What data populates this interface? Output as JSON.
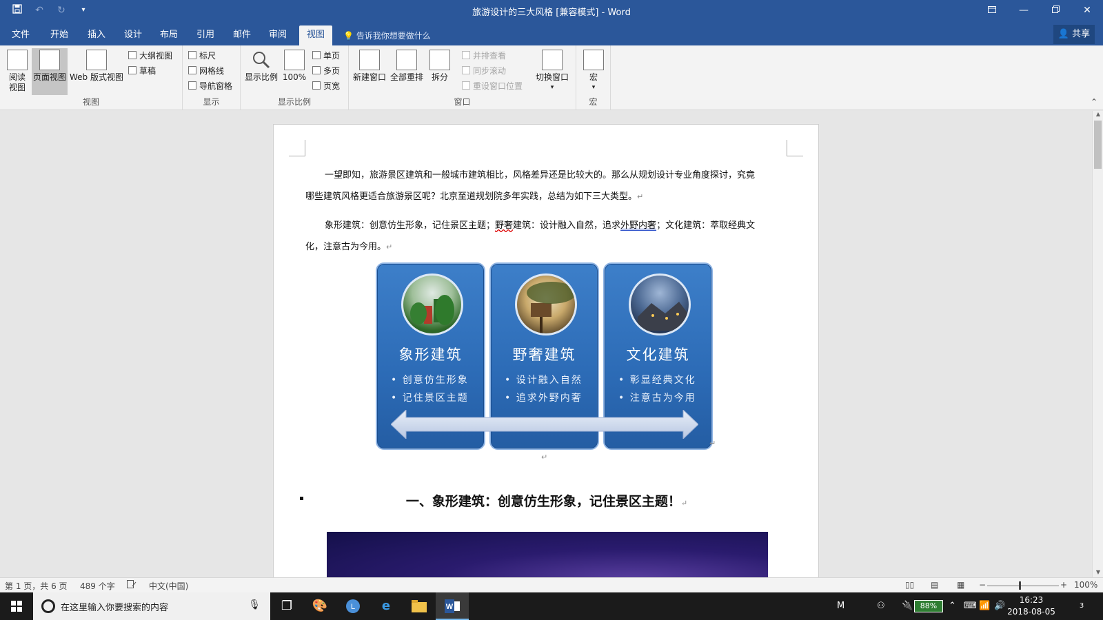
{
  "window": {
    "title": "旅游设计的三大风格 [兼容模式] - Word",
    "qat": {
      "save_icon": "save-icon",
      "undo_icon": "undo-icon",
      "redo_icon": "redo-icon",
      "customize_icon": "customize-icon"
    },
    "controls": {
      "ribbon_display": "ribbon-display-icon",
      "minimize": "minimize-icon",
      "restore": "restore-icon",
      "close": "close-icon"
    }
  },
  "tabs": [
    {
      "label": "文件"
    },
    {
      "label": "开始"
    },
    {
      "label": "插入"
    },
    {
      "label": "设计"
    },
    {
      "label": "布局"
    },
    {
      "label": "引用"
    },
    {
      "label": "邮件"
    },
    {
      "label": "审阅"
    },
    {
      "label": "视图",
      "active": true
    }
  ],
  "tell_me": "告诉我你想要做什么",
  "share": "共享",
  "ribbon": {
    "views": {
      "label": "视图",
      "read_mode": "阅读\n视图",
      "print_layout": "页面视图",
      "web_layout": "Web 版式视图",
      "outline": "大纲视图",
      "draft": "草稿"
    },
    "show": {
      "label": "显示",
      "ruler": "标尺",
      "gridlines": "网格线",
      "nav_pane": "导航窗格"
    },
    "zoom": {
      "label": "显示比例",
      "zoom": "显示比例",
      "hundred": "100%",
      "one_page": "单页",
      "multi_page": "多页",
      "page_width": "页宽"
    },
    "window": {
      "label": "窗口",
      "new_window": "新建窗口",
      "arrange_all": "全部重排",
      "split": "拆分",
      "side_by_side": "并排查看",
      "sync_scroll": "同步滚动",
      "reset_pos": "重设窗口位置",
      "switch_windows": "切换窗口"
    },
    "macros": {
      "label": "宏",
      "macros": "宏"
    }
  },
  "document": {
    "para1_line1": "一望即知，旅游景区建筑和一般城市建筑相比，风格差异还是比较大的。那么从规划设计专业角度探讨，究竟",
    "para1_line2": "哪些建筑风格更适合旅游景区呢？北京至道规划院多年实践，总结为如下三大类型。",
    "para2_line1_a": "象形建筑：创意仿生形象，记住景区主题；",
    "para2_line1_b": "野奢",
    "para2_line1_c": "建筑：设计融入自然，追求",
    "para2_line1_d": "外野内奢",
    "para2_line1_e": "；文化建筑：萃取经典文",
    "para2_line2": "化，注意古为今用。",
    "para_mark": "↵",
    "cards": [
      {
        "title": "象形建筑",
        "bullets": [
          "• 创意仿生形象",
          "• 记住景区主题"
        ]
      },
      {
        "title": "野奢建筑",
        "bullets": [
          "• 设计融入自然",
          "• 追求外野内奢"
        ]
      },
      {
        "title": "文化建筑",
        "bullets": [
          "• 彰显经典文化",
          "• 注意古为今用"
        ]
      }
    ],
    "heading": "一、象形建筑：创意仿生形象，记住景区主题！"
  },
  "status": {
    "page": "第 1 页，共 6 页",
    "words": "489 个字",
    "language": "中文(中国)",
    "zoom": "100%",
    "zoom_minus": "−",
    "zoom_plus": "+"
  },
  "taskbar": {
    "search_placeholder": "在这里输入你要搜索的内容",
    "ime": "M",
    "battery": "88%",
    "time": "16:23",
    "date": "2018-08-05",
    "notifications": "3"
  },
  "colors": {
    "word_blue": "#2b579a",
    "card_blue": "#2c6bb6"
  }
}
